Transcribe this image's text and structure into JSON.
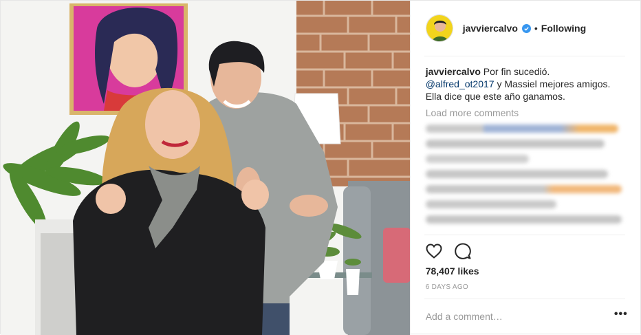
{
  "post": {
    "author": "javviercalvo",
    "follow_status": "Following",
    "separator": "•",
    "caption": {
      "user": "javviercalvo",
      "text_before": "Por fin sucedió.",
      "mention": "@alfred_ot2017",
      "text_after": " y Massiel mejores amigos. Ella dice que este año ganamos."
    },
    "load_more": "Load more comments",
    "likes": "78,407 likes",
    "time_ago": "6 DAYS AGO",
    "comment_placeholder": "Add a comment…",
    "more_options": "•••"
  },
  "icons": {
    "verified": "verified-badge-icon",
    "like": "heart-icon",
    "comment": "speech-bubble-icon"
  },
  "colors": {
    "accent_blue": "#3897f0",
    "mention": "#003569",
    "muted": "#999999",
    "text": "#262626"
  }
}
